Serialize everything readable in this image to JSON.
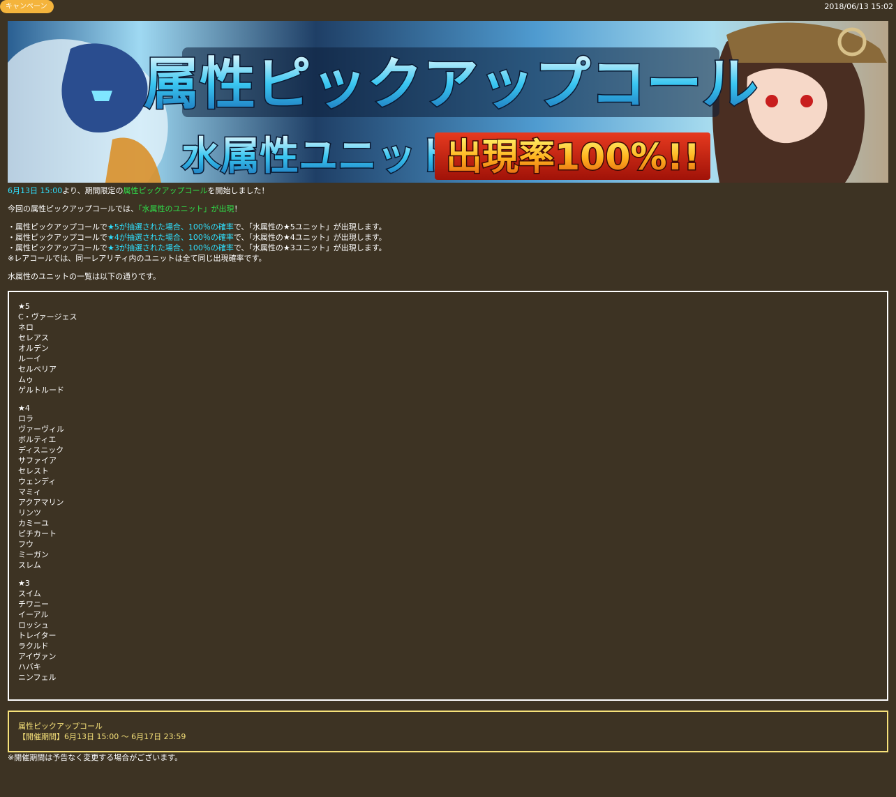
{
  "header": {
    "category_badge": "キャンペーン",
    "datetime": "2018/06/13 15:02"
  },
  "banner": {
    "title_text": "属性ピックアップコール",
    "subtitle_text": "水属性ユニット",
    "rate_text": "出現率100%!!"
  },
  "intro": {
    "start_time": "6月13日 15:00",
    "text_1": "より、期間限定の",
    "event_name": "属性ピックアップコール",
    "text_2": "を開始しました！"
  },
  "summary": {
    "text_1": "今回の属性ピックアップコールでは、",
    "highlight": "「水属性のユニット」が出現",
    "text_2": "！"
  },
  "rules": [
    {
      "prefix": "・属性ピックアップコールで",
      "highlight": "★5が抽選された場合、100％の確率",
      "suffix": "で、「水属性の★5ユニット」が出現します。"
    },
    {
      "prefix": "・属性ピックアップコールで",
      "highlight": "★4が抽選された場合、100％の確率",
      "suffix": "で、「水属性の★4ユニット」が出現します。"
    },
    {
      "prefix": "・属性ピックアップコールで",
      "highlight": "★3が抽選された場合、100％の確率",
      "suffix": "で、「水属性の★3ユニット」が出現します。"
    }
  ],
  "rules_note": "※レアコールでは、同一レアリティ内のユニットは全て同じ出現確率です。",
  "list_intro": "水属性のユニットの一覧は以下の通りです。",
  "unit_groups": [
    {
      "rarity": "★5",
      "units": [
        "C・ヴァージェス",
        "ネロ",
        "セレアス",
        "オルデン",
        "ルーイ",
        "セルベリア",
        "ムゥ",
        "ゲルトルード"
      ]
    },
    {
      "rarity": "★4",
      "units": [
        "ロラ",
        "ヴァーヴィル",
        "ボルティエ",
        "ディスニック",
        "サファイア",
        "セレスト",
        "ウェンディ",
        "マミィ",
        "アクアマリン",
        "リンツ",
        "カミーユ",
        "ピチカート",
        "フウ",
        "ミーガン",
        "スレム"
      ]
    },
    {
      "rarity": "★3",
      "units": [
        "スイム",
        "チワニー",
        "イーアル",
        "ロッシュ",
        "トレイター",
        "ラクルド",
        "アイヴァン",
        "ハバキ",
        "ニンフェル"
      ]
    }
  ],
  "period": {
    "title": "属性ピックアップコール",
    "schedule": "【開催期間】6月13日 15:00 ～ 6月17日 23:59"
  },
  "footer_note": "※開催期間は予告なく変更する場合がございます。",
  "colors": {
    "background": "#3d3323",
    "badge": "#f4b43c",
    "cyan_highlight": "#2fe0ff",
    "green_highlight": "#2fe04a",
    "period_border": "#f7e27a"
  }
}
